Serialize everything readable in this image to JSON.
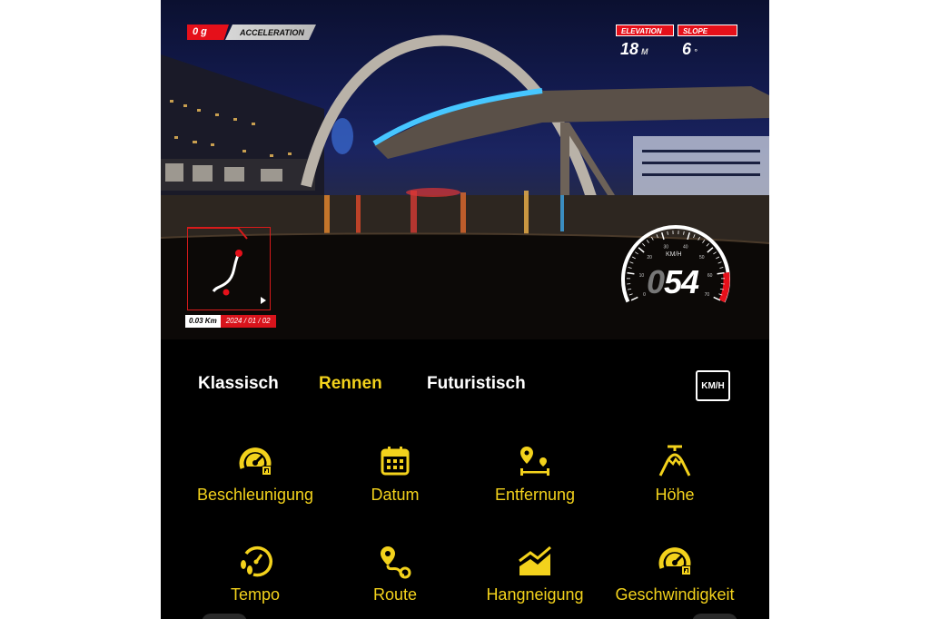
{
  "hud": {
    "acceleration": {
      "value": "0 g",
      "label": "ACCELERATION"
    },
    "elevation": {
      "label": "ELEVATION",
      "value": "18",
      "unit": "M"
    },
    "slope": {
      "label": "SLOPE",
      "value": "6",
      "unit": "°"
    },
    "map": {
      "distance": "0.03 Km",
      "date": "2024 / 01 / 02"
    },
    "speedometer": {
      "unit": "KM/H",
      "lead_digit": "0",
      "digits": "54",
      "ticks": [
        "0",
        "10",
        "20",
        "30",
        "40",
        "50",
        "60",
        "70"
      ],
      "speed_value": 54,
      "max_value": 70,
      "accent_color": "#e5101a"
    }
  },
  "tabs": [
    {
      "label": "Klassisch",
      "active": false
    },
    {
      "label": "Rennen",
      "active": true
    },
    {
      "label": "Futuristisch",
      "active": false
    }
  ],
  "unit_toggle": {
    "label": "KM/H"
  },
  "widgets": [
    {
      "label": "Beschleunigung",
      "icon": "gauge-icon"
    },
    {
      "label": "Datum",
      "icon": "calendar-icon"
    },
    {
      "label": "Entfernung",
      "icon": "distance-pin-icon"
    },
    {
      "label": "Höhe",
      "icon": "mountain-icon"
    },
    {
      "label": "Tempo",
      "icon": "footsteps-pace-icon"
    },
    {
      "label": "Route",
      "icon": "route-icon"
    },
    {
      "label": "Hangneigung",
      "icon": "slope-icon"
    },
    {
      "label": "Geschwindigkeit",
      "icon": "speedometer-icon"
    }
  ],
  "colors": {
    "accent_yellow": "#f3d21c",
    "hud_red": "#e5101a",
    "background": "#000000"
  }
}
